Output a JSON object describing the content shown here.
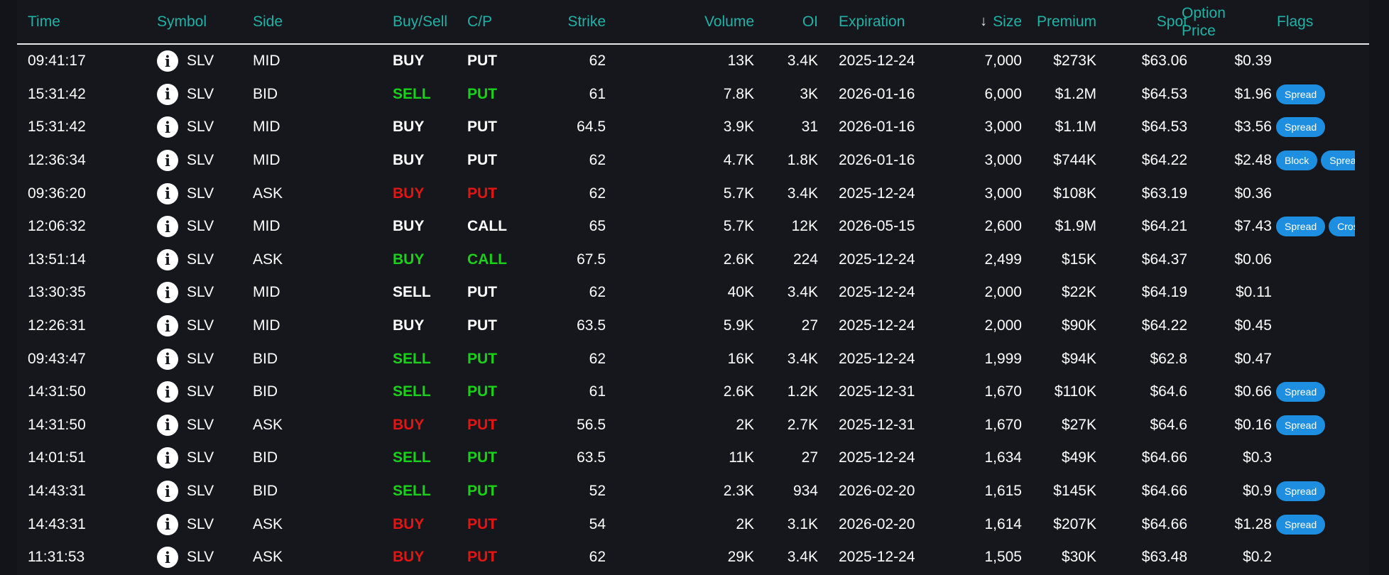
{
  "columns": {
    "time": "Time",
    "symbol": "Symbol",
    "side": "Side",
    "buysell": "Buy/Sell",
    "cp": "C/P",
    "strike": "Strike",
    "volume": "Volume",
    "oi": "OI",
    "expiration": "Expiration",
    "size": "Size",
    "sort_icon": "arrow-down-icon",
    "premium": "Premium",
    "spot": "Spot",
    "option_price_line1": "Option",
    "option_price_line2": "Price",
    "flags": "Flags"
  },
  "colors": {
    "header_text": "#1fb2a6",
    "sell_bid": "#19d119",
    "buy_ask": "#e31414",
    "badge": "#1e8fe0"
  },
  "rows": [
    {
      "time": "09:41:17",
      "symbol": "SLV",
      "side": "MID",
      "buysell": "BUY",
      "cp": "PUT",
      "strike": "62",
      "volume": "13K",
      "oi": "3.4K",
      "expiration": "2025-12-24",
      "size": "7,000",
      "premium": "$273K",
      "spot": "$63.06",
      "option_price": "$0.39",
      "flags": [],
      "tone": "white"
    },
    {
      "time": "15:31:42",
      "symbol": "SLV",
      "side": "BID",
      "buysell": "SELL",
      "cp": "PUT",
      "strike": "61",
      "volume": "7.8K",
      "oi": "3K",
      "expiration": "2026-01-16",
      "size": "6,000",
      "premium": "$1.2M",
      "spot": "$64.53",
      "option_price": "$1.96",
      "flags": [
        "Spread"
      ],
      "tone": "green"
    },
    {
      "time": "15:31:42",
      "symbol": "SLV",
      "side": "MID",
      "buysell": "BUY",
      "cp": "PUT",
      "strike": "64.5",
      "volume": "3.9K",
      "oi": "31",
      "expiration": "2026-01-16",
      "size": "3,000",
      "premium": "$1.1M",
      "spot": "$64.53",
      "option_price": "$3.56",
      "flags": [
        "Spread"
      ],
      "tone": "white"
    },
    {
      "time": "12:36:34",
      "symbol": "SLV",
      "side": "MID",
      "buysell": "BUY",
      "cp": "PUT",
      "strike": "62",
      "volume": "4.7K",
      "oi": "1.8K",
      "expiration": "2026-01-16",
      "size": "3,000",
      "premium": "$744K",
      "spot": "$64.22",
      "option_price": "$2.48",
      "flags": [
        "Block",
        "Spread"
      ],
      "tone": "white"
    },
    {
      "time": "09:36:20",
      "symbol": "SLV",
      "side": "ASK",
      "buysell": "BUY",
      "cp": "PUT",
      "strike": "62",
      "volume": "5.7K",
      "oi": "3.4K",
      "expiration": "2025-12-24",
      "size": "3,000",
      "premium": "$108K",
      "spot": "$63.19",
      "option_price": "$0.36",
      "flags": [],
      "tone": "red"
    },
    {
      "time": "12:06:32",
      "symbol": "SLV",
      "side": "MID",
      "buysell": "BUY",
      "cp": "CALL",
      "strike": "65",
      "volume": "5.7K",
      "oi": "12K",
      "expiration": "2026-05-15",
      "size": "2,600",
      "premium": "$1.9M",
      "spot": "$64.21",
      "option_price": "$7.43",
      "flags": [
        "Spread",
        "Cross"
      ],
      "tone": "white"
    },
    {
      "time": "13:51:14",
      "symbol": "SLV",
      "side": "ASK",
      "buysell": "BUY",
      "cp": "CALL",
      "strike": "67.5",
      "volume": "2.6K",
      "oi": "224",
      "expiration": "2025-12-24",
      "size": "2,499",
      "premium": "$15K",
      "spot": "$64.37",
      "option_price": "$0.06",
      "flags": [],
      "tone": "green"
    },
    {
      "time": "13:30:35",
      "symbol": "SLV",
      "side": "MID",
      "buysell": "SELL",
      "cp": "PUT",
      "strike": "62",
      "volume": "40K",
      "oi": "3.4K",
      "expiration": "2025-12-24",
      "size": "2,000",
      "premium": "$22K",
      "spot": "$64.19",
      "option_price": "$0.11",
      "flags": [],
      "tone": "white"
    },
    {
      "time": "12:26:31",
      "symbol": "SLV",
      "side": "MID",
      "buysell": "BUY",
      "cp": "PUT",
      "strike": "63.5",
      "volume": "5.9K",
      "oi": "27",
      "expiration": "2025-12-24",
      "size": "2,000",
      "premium": "$90K",
      "spot": "$64.22",
      "option_price": "$0.45",
      "flags": [],
      "tone": "white"
    },
    {
      "time": "09:43:47",
      "symbol": "SLV",
      "side": "BID",
      "buysell": "SELL",
      "cp": "PUT",
      "strike": "62",
      "volume": "16K",
      "oi": "3.4K",
      "expiration": "2025-12-24",
      "size": "1,999",
      "premium": "$94K",
      "spot": "$62.8",
      "option_price": "$0.47",
      "flags": [],
      "tone": "green"
    },
    {
      "time": "14:31:50",
      "symbol": "SLV",
      "side": "BID",
      "buysell": "SELL",
      "cp": "PUT",
      "strike": "61",
      "volume": "2.6K",
      "oi": "1.2K",
      "expiration": "2025-12-31",
      "size": "1,670",
      "premium": "$110K",
      "spot": "$64.6",
      "option_price": "$0.66",
      "flags": [
        "Spread"
      ],
      "tone": "green"
    },
    {
      "time": "14:31:50",
      "symbol": "SLV",
      "side": "ASK",
      "buysell": "BUY",
      "cp": "PUT",
      "strike": "56.5",
      "volume": "2K",
      "oi": "2.7K",
      "expiration": "2025-12-31",
      "size": "1,670",
      "premium": "$27K",
      "spot": "$64.6",
      "option_price": "$0.16",
      "flags": [
        "Spread"
      ],
      "tone": "red"
    },
    {
      "time": "14:01:51",
      "symbol": "SLV",
      "side": "BID",
      "buysell": "SELL",
      "cp": "PUT",
      "strike": "63.5",
      "volume": "11K",
      "oi": "27",
      "expiration": "2025-12-24",
      "size": "1,634",
      "premium": "$49K",
      "spot": "$64.66",
      "option_price": "$0.3",
      "flags": [],
      "tone": "green"
    },
    {
      "time": "14:43:31",
      "symbol": "SLV",
      "side": "BID",
      "buysell": "SELL",
      "cp": "PUT",
      "strike": "52",
      "volume": "2.3K",
      "oi": "934",
      "expiration": "2026-02-20",
      "size": "1,615",
      "premium": "$145K",
      "spot": "$64.66",
      "option_price": "$0.9",
      "flags": [
        "Spread"
      ],
      "tone": "green"
    },
    {
      "time": "14:43:31",
      "symbol": "SLV",
      "side": "ASK",
      "buysell": "BUY",
      "cp": "PUT",
      "strike": "54",
      "volume": "2K",
      "oi": "3.1K",
      "expiration": "2026-02-20",
      "size": "1,614",
      "premium": "$207K",
      "spot": "$64.66",
      "option_price": "$1.28",
      "flags": [
        "Spread"
      ],
      "tone": "red"
    },
    {
      "time": "11:31:53",
      "symbol": "SLV",
      "side": "ASK",
      "buysell": "BUY",
      "cp": "PUT",
      "strike": "62",
      "volume": "29K",
      "oi": "3.4K",
      "expiration": "2025-12-24",
      "size": "1,505",
      "premium": "$30K",
      "spot": "$63.48",
      "option_price": "$0.2",
      "flags": [],
      "tone": "red"
    }
  ]
}
